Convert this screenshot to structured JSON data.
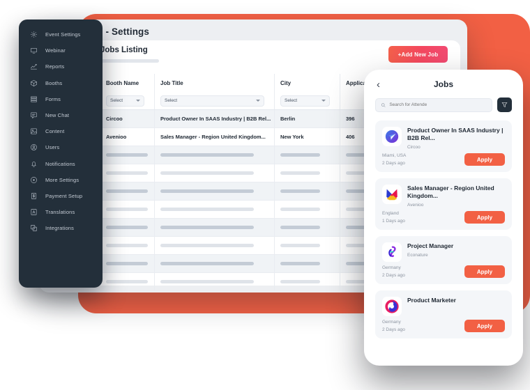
{
  "sidebar": {
    "items": [
      {
        "label": "Event Settings",
        "icon": "gear-icon"
      },
      {
        "label": "Webinar",
        "icon": "monitor-icon"
      },
      {
        "label": "Reports",
        "icon": "chart-line-icon"
      },
      {
        "label": "Booths",
        "icon": "box-icon"
      },
      {
        "label": "Forms",
        "icon": "layers-icon"
      },
      {
        "label": "New Chat",
        "icon": "chat-icon"
      },
      {
        "label": "Content",
        "icon": "image-icon"
      },
      {
        "label": "Users",
        "icon": "user-circle-icon"
      },
      {
        "label": "Notifications",
        "icon": "bell-icon"
      },
      {
        "label": "More Settings",
        "icon": "dot-circle-icon"
      },
      {
        "label": "Payment Setup",
        "icon": "dollar-icon"
      },
      {
        "label": "Translations",
        "icon": "translate-icon"
      },
      {
        "label": "Integrations",
        "icon": "plugin-icon"
      }
    ]
  },
  "desktop": {
    "title": "Job Board - Settings",
    "panel": {
      "title": "Jobs Listing",
      "add_button": "+Add New Job",
      "table": {
        "columns": [
          "Booth Name",
          "Job Title",
          "City",
          "Applicant C"
        ],
        "filter_placeholder": "Select",
        "rows": [
          {
            "booth": "Circoo",
            "job": "Product Owner In SAAS Industry | B2B Rel...",
            "city": "Berlin",
            "applicants": "396"
          },
          {
            "booth": "Avenioo",
            "job": "Sales Manager - Region United Kingdom...",
            "city": "New York",
            "applicants": "406"
          }
        ],
        "skeleton_row_count": 8
      }
    }
  },
  "mobile": {
    "title": "Jobs",
    "back_icon": "chevron-left-icon",
    "search": {
      "placeholder": "Search for Attende",
      "value": ""
    },
    "filter_icon": "filter-icon",
    "jobs": [
      {
        "title": "Product Owner In SAAS Industry | B2B Rel...",
        "company": "Circoo",
        "location": "Miami, USA",
        "time": "2 Days ago",
        "apply": "Apply",
        "logo": "circoo-logo"
      },
      {
        "title": "Sales Manager - Region United Kingdom...",
        "company": "Avenioo",
        "location": "England",
        "time": "1 Days ago",
        "apply": "Apply",
        "logo": "avenioo-logo"
      },
      {
        "title": "Project Manager",
        "company": "Econature",
        "location": "Germany",
        "time": "2 Days ago",
        "apply": "Apply",
        "logo": "econature-logo"
      },
      {
        "title": "Product Marketer",
        "company": "",
        "location": "Germany",
        "time": "2 Days ago",
        "apply": "Apply",
        "logo": "marketer-logo"
      }
    ]
  },
  "colors": {
    "accent": "#F26044",
    "sidebar": "#232F3A",
    "content_bg": "#EDEFF2"
  }
}
